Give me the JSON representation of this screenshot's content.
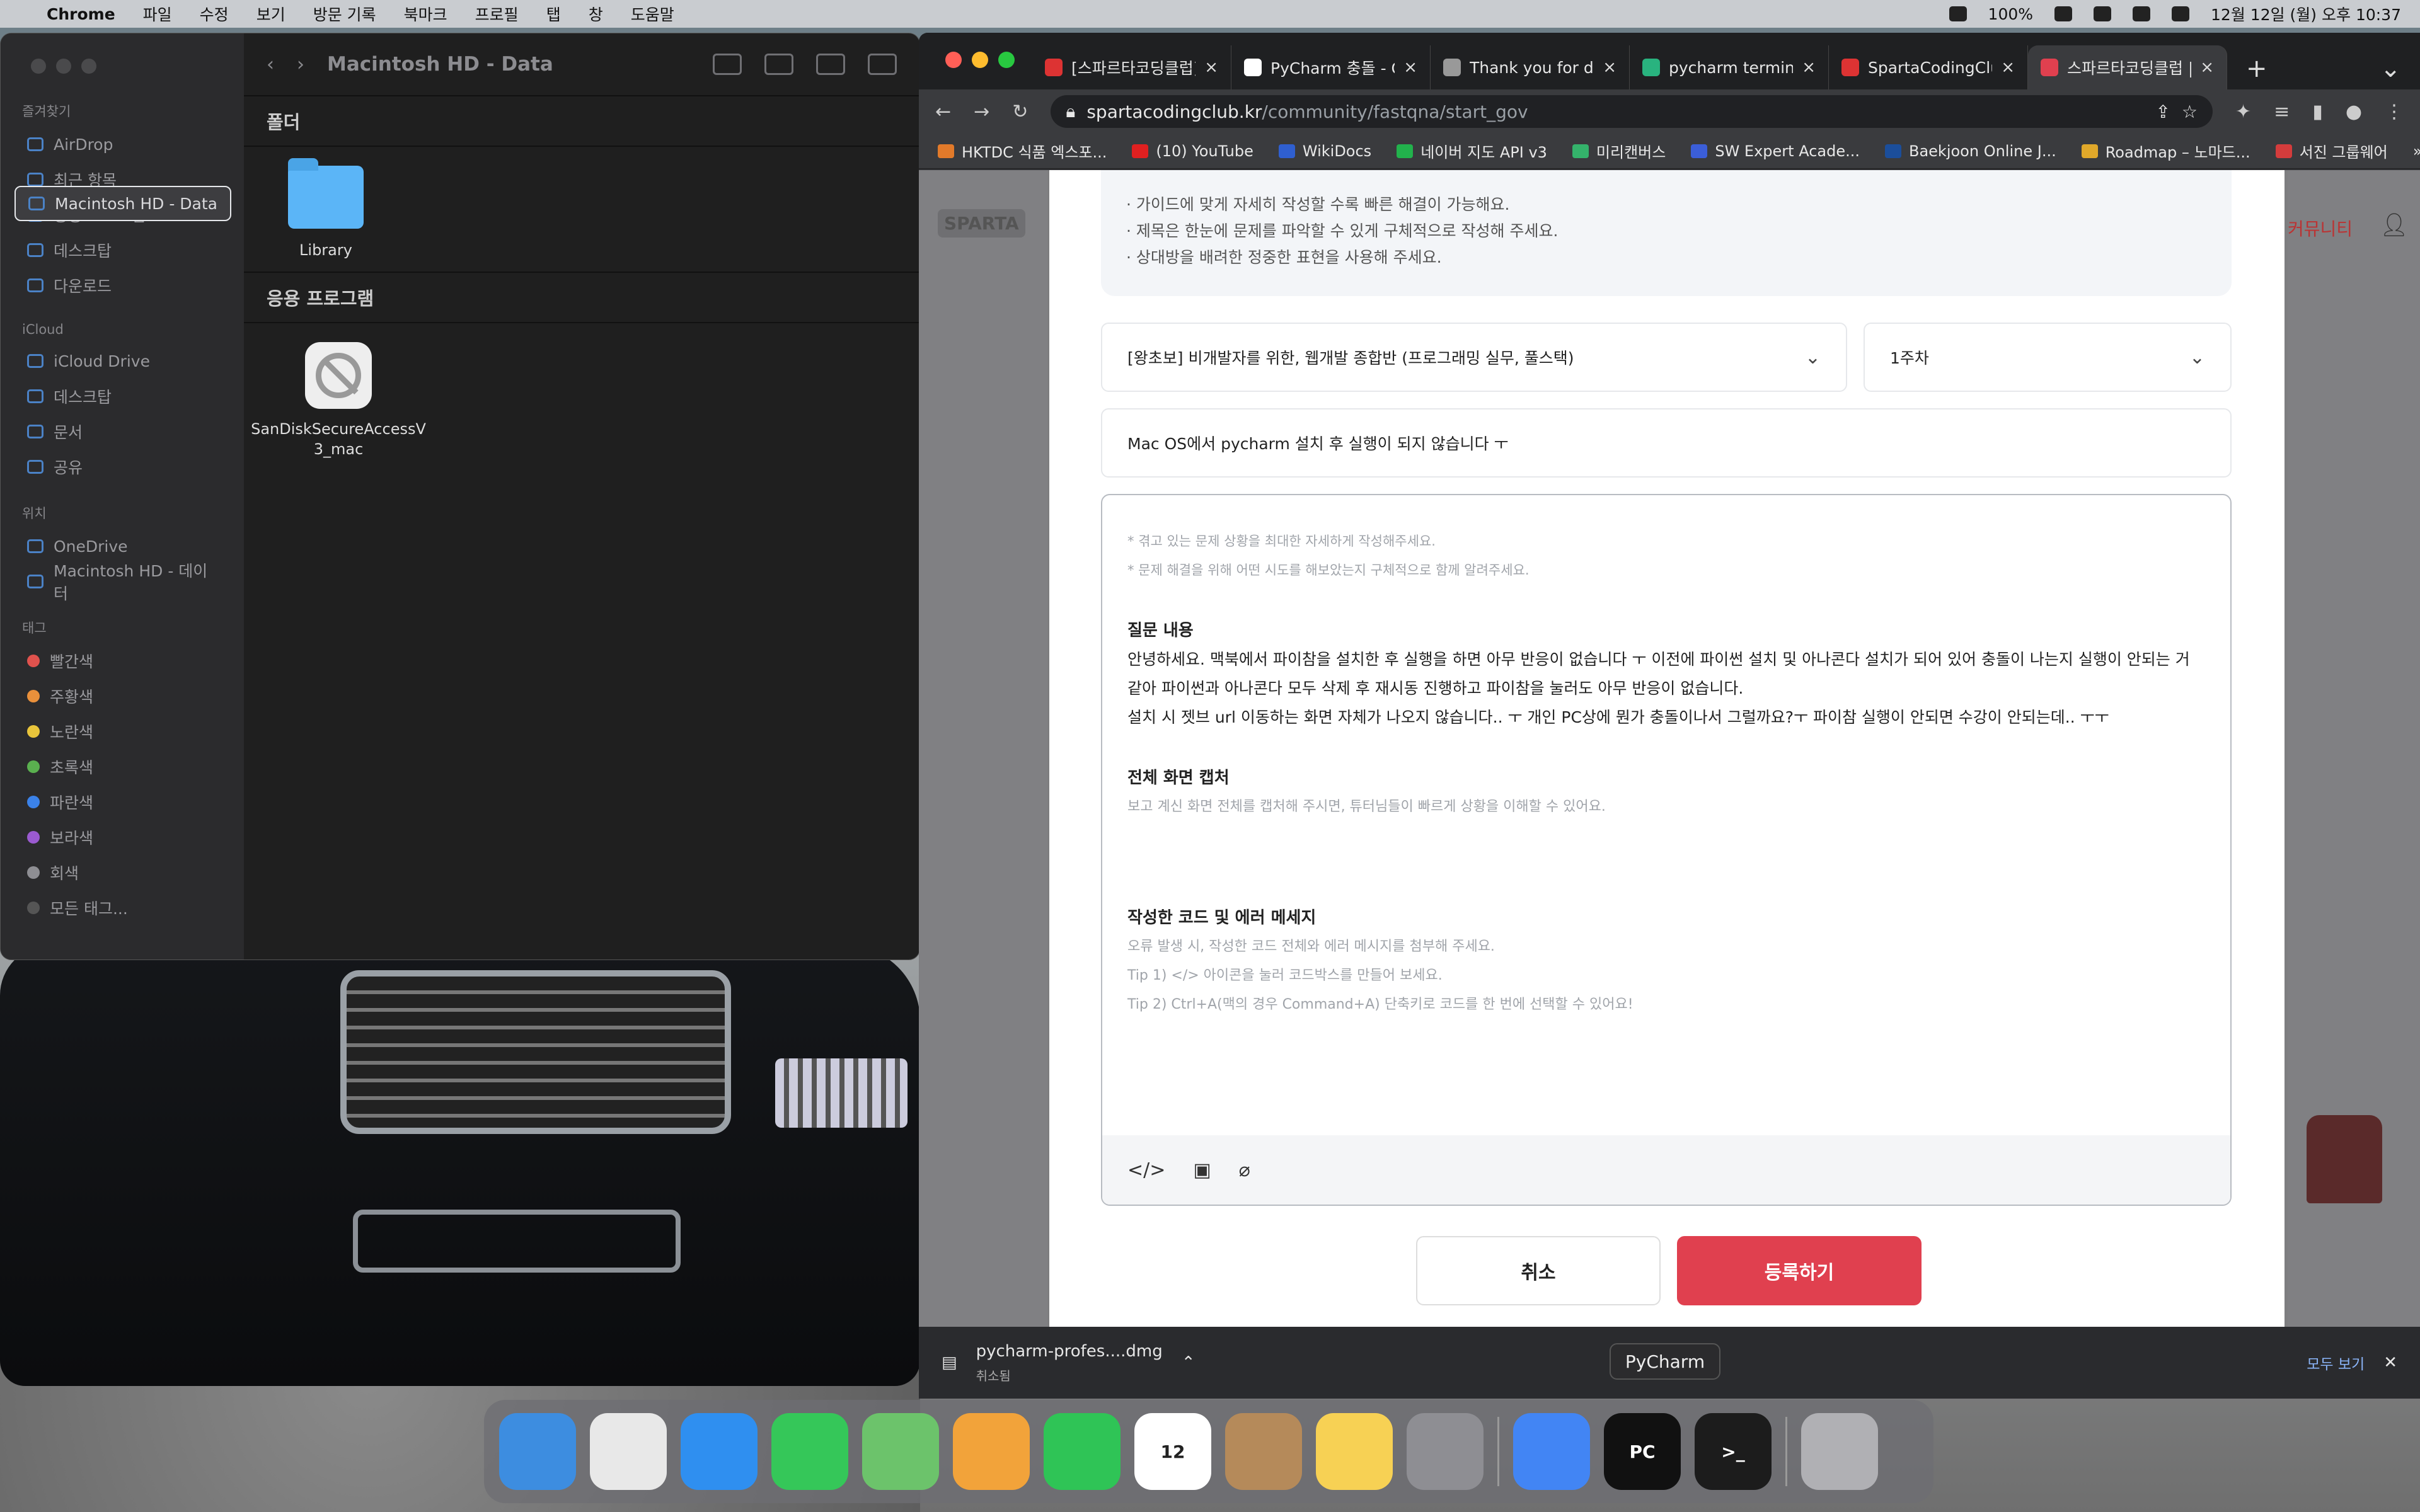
{
  "menubar": {
    "app": "Chrome",
    "menus": [
      "파일",
      "수정",
      "보기",
      "방문 기록",
      "북마크",
      "프로필",
      "탭",
      "창",
      "도움말"
    ],
    "battery": "100%",
    "clock": "12월 12일 (월) 오후 10:37"
  },
  "finder": {
    "path": "Macintosh HD - Data",
    "sections": [
      {
        "title": "즐겨찾기",
        "items": [
          "AirDrop",
          "최근 항목",
          "응용 프로그램",
          "데스크탑",
          "다운로드"
        ]
      },
      {
        "title": "iCloud",
        "items": [
          "iCloud Drive",
          "데스크탑",
          "문서",
          "공유"
        ]
      },
      {
        "title": "위치",
        "items": [
          "OneDrive",
          "Macintosh HD - Data",
          "Macintosh HD - 데이터"
        ]
      }
    ],
    "tags_title": "태그",
    "tags": [
      {
        "name": "빨간색",
        "color": "#e0524d"
      },
      {
        "name": "주황색",
        "color": "#e9903b"
      },
      {
        "name": "노란색",
        "color": "#e9c53b"
      },
      {
        "name": "초록색",
        "color": "#5ab04f"
      },
      {
        "name": "파란색",
        "color": "#3b82e9"
      },
      {
        "name": "보라색",
        "color": "#9a5ad0"
      },
      {
        "name": "회색",
        "color": "#8e8e93"
      },
      {
        "name": "모든 태그...",
        "color": "#555"
      }
    ],
    "folder_section": "폴더",
    "folder_name": "Library",
    "apps_section": "응용 프로그램",
    "app_name": "SanDiskSecureAccessV3_mac"
  },
  "chrome": {
    "tabs": [
      {
        "label": "[스파르타코딩클럽]",
        "color": "#d33"
      },
      {
        "label": "PyCharm 충돌 - G",
        "color": "#fff"
      },
      {
        "label": "Thank you for do",
        "color": "#999"
      },
      {
        "label": "pycharm termina",
        "color": "#29b37f"
      },
      {
        "label": "SpartaCodingClu",
        "color": "#d33"
      },
      {
        "label": "스파르타코딩클럽 |",
        "color": "#e0404f"
      }
    ],
    "url_host": "spartacodingclub.kr",
    "url_path": "/community/fastqna/start_gov",
    "bookmarks": [
      {
        "label": "HKTDC 식품 엑스포...",
        "color": "#e27a2a"
      },
      {
        "label": "(10) YouTube",
        "color": "#e02020"
      },
      {
        "label": "WikiDocs",
        "color": "#2f5fd0"
      },
      {
        "label": "네이버 지도 API v3",
        "color": "#22b24c"
      },
      {
        "label": "미리캔버스",
        "color": "#34b36b"
      },
      {
        "label": "SW Expert Acade...",
        "color": "#3b5ed8"
      },
      {
        "label": "Baekjoon Online J...",
        "color": "#1b4e9b"
      },
      {
        "label": "Roadmap – 노마드...",
        "color": "#e0a82a"
      },
      {
        "label": "서진 그룹웨어",
        "color": "#d43c3c"
      }
    ]
  },
  "form": {
    "guide": [
      "· 가이드에 맞게 자세히 작성할 수록 빠른 해결이 가능해요.",
      "· 제목은 한눈에 문제를 파악할 수 있게 구체적으로 작성해 주세요.",
      "· 상대방을 배려한 정중한 표현을 사용해 주세요."
    ],
    "course": "[왕초보] 비개발자를 위한, 웹개발 종합반 (프로그래밍 실무, 풀스택)",
    "week": "1주차",
    "title": "Mac OS에서 pycharm 설치 후 실행이 되지 않습니다 ㅜ",
    "placeholder1": "* 겪고 있는 문제 상황을 최대한 자세하게 작성해주세요.",
    "placeholder2": "* 문제 해결을 위해 어떤 시도를 해보았는지 구체적으로 함께 알려주세요.",
    "q_heading": "질문 내용",
    "q_body1": "안녕하세요. 맥북에서 파이참을 설치한 후 실행을 하면 아무 반응이 없습니다 ㅜ 이전에 파이썬 설치 및 아나콘다 설치가 되어 있어 충돌이 나는지 실행이 안되는 거 같아 파이썬과 아나콘다 모두 삭제 후 재시동 진행하고 파이참을 눌러도 아무 반응이 없습니다.",
    "q_body2": "설치 시 젯브 url 이동하는 화면 자체가 나오지 않습니다.. ㅜ 개인 PC상에 뭔가 충돌이나서 그럴까요?ㅜ 파이참 실행이 안되면 수강이 안되는데.. ㅜㅜ",
    "cap_heading": "전체 화면 캡처",
    "cap_tip": "보고 계신 화면 전체를 캡처해 주시면, 튜터님들이 빠르게 상황을 이해할 수 있어요.",
    "code_heading": "작성한 코드 및 에러 메세지",
    "code_tip1": "오류 발생 시, 작성한 코드 전체와 에러 메시지를 첨부해 주세요.",
    "code_tip2": "Tip 1) </> 아이콘을 눌러 코드박스를 만들어 보세요.",
    "code_tip3": "Tip 2) Ctrl+A(맥의 경우 Command+A) 단축키로 코드를 한 번에 선택할 수 있어요!",
    "cancel": "취소",
    "submit": "등록하기",
    "site_right": "커뮤니티"
  },
  "download": {
    "file": "pycharm-profes....dmg",
    "status": "취소됨",
    "show_all": "모두 보기"
  },
  "tooltip": "PyCharm",
  "dock": [
    {
      "name": "finder",
      "color": "#3d8de0",
      "label": ""
    },
    {
      "name": "launchpad",
      "color": "#e8e8e8",
      "label": ""
    },
    {
      "name": "safari",
      "color": "#2f8ff0",
      "label": ""
    },
    {
      "name": "messages",
      "color": "#35c759",
      "label": ""
    },
    {
      "name": "maps",
      "color": "#6cc36b",
      "label": ""
    },
    {
      "name": "photos",
      "color": "#f2a33a",
      "label": ""
    },
    {
      "name": "facetime",
      "color": "#2fc456",
      "label": ""
    },
    {
      "name": "calendar",
      "color": "#ffffff",
      "label": "12"
    },
    {
      "name": "contacts",
      "color": "#b58a5a",
      "label": ""
    },
    {
      "name": "notes",
      "color": "#f7d154",
      "label": ""
    },
    {
      "name": "system-settings",
      "color": "#8e8e93",
      "label": ""
    },
    {
      "name": "chrome",
      "color": "#4285f4",
      "label": ""
    },
    {
      "name": "pycharm",
      "color": "#111111",
      "label": "PC"
    },
    {
      "name": "terminal",
      "color": "#1c1c1c",
      "label": ">_"
    },
    {
      "name": "trash",
      "color": "#b0b0b4",
      "label": ""
    }
  ]
}
